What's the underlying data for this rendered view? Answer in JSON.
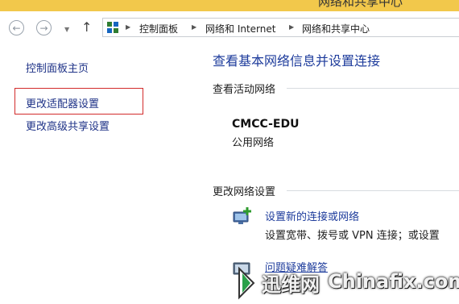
{
  "window": {
    "title_fragment": "网络和共享中心"
  },
  "navigation": {
    "back_icon": "back-arrow-icon",
    "forward_icon": "forward-arrow-icon",
    "up_icon": "up-arrow-icon",
    "breadcrumb": [
      "控制面板",
      "网络和 Internet",
      "网络和共享中心"
    ]
  },
  "sidebar": {
    "items": [
      {
        "label": "控制面板主页"
      },
      {
        "label": "更改适配器设置",
        "highlighted": true
      },
      {
        "label": "更改高级共享设置"
      }
    ]
  },
  "main": {
    "title": "查看基本网络信息并设置连接",
    "active_networks": {
      "label": "查看活动网络",
      "network_name": "CMCC-EDU",
      "network_type": "公用网络"
    },
    "change_settings": {
      "label": "更改网络设置",
      "tasks": [
        {
          "link": "设置新的连接或网络",
          "description": "设置宽带、拨号或 VPN 连接；或设置",
          "icon": "new-connection-icon"
        },
        {
          "link": "问题疑难解答",
          "icon": "troubleshoot-icon"
        }
      ]
    }
  },
  "watermark": {
    "cn": "迅维网",
    "en": "Chinafix.com"
  },
  "colors": {
    "link": "#1e3287",
    "title": "#1e3c9c",
    "highlight_border": "#d22b2b",
    "titlebar": "#f2c84b"
  }
}
